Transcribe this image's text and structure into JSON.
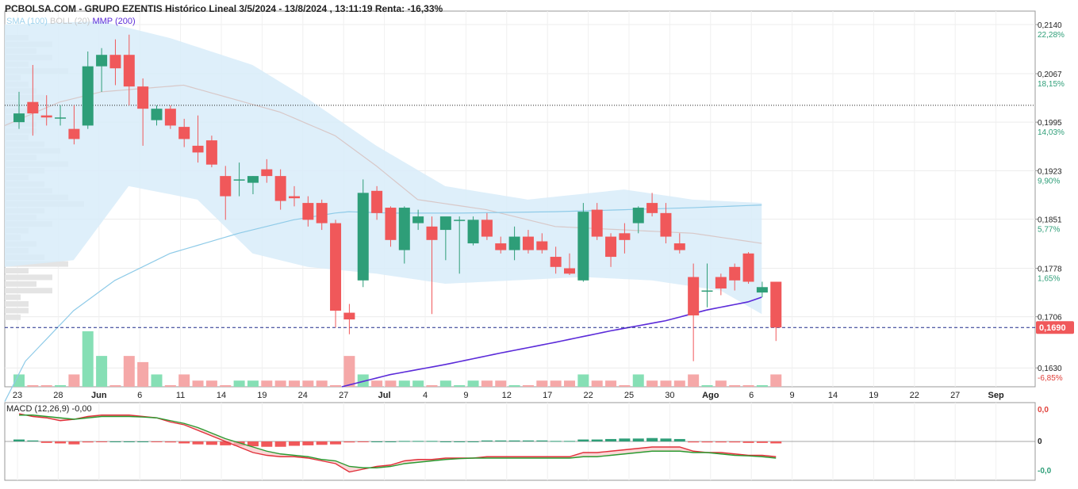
{
  "header": {
    "title": "PCBOLSA.COM - GRUPO EZENTIS Histórico Lineal 3/5/2024 - 13/8/2024 , 13:11:19 Renta: -16,33%"
  },
  "legend": [
    {
      "label": "SMA (100)",
      "color": "#9fd3ee"
    },
    {
      "label": "BOLL (20)",
      "color": "#c8c8c8"
    },
    {
      "label": "MMP (200)",
      "color": "#5b2bd9"
    }
  ],
  "colors": {
    "up": "#2e9e78",
    "down": "#f0585a",
    "vol_up": "#86dfb5",
    "vol_down": "#f5a8a8",
    "boll_fill": "#d8ecf9",
    "sma": "#8fcbe8",
    "mmp": "#5b2bd9",
    "macd_line": "#e0303a",
    "signal_line": "#2a9a30"
  },
  "chart_data": [
    {
      "type": "candlestick",
      "title": "PCBOLSA.COM - GRUPO EZENTIS Histórico Lineal 3/5/2024 - 13/8/2024 , 13:11:19 Renta: -16,33%",
      "ylim": [
        0.1602,
        0.216
      ],
      "y_ticks": [
        {
          "value": 0.214,
          "label": "0,2140",
          "pct": "22,28%"
        },
        {
          "value": 0.2067,
          "label": "0,2067",
          "pct": "18,15%"
        },
        {
          "value": 0.1995,
          "label": "0,1995",
          "pct": "14,03%"
        },
        {
          "value": 0.1923,
          "label": "0,1923",
          "pct": "9,90%"
        },
        {
          "value": 0.1851,
          "label": "5,77%",
          "pct": "5,77%",
          "price": "0,1851"
        },
        {
          "value": 0.1778,
          "label": "0,1778",
          "pct": "1,65%"
        },
        {
          "value": 0.1706,
          "label": "0,1706",
          "pct": "-2,47%"
        },
        {
          "value": 0.163,
          "label": "0,1630",
          "pct": "-6,85%"
        }
      ],
      "x_ticks": [
        "23",
        "28",
        "Jun",
        "6",
        "11",
        "14",
        "19",
        "24",
        "27",
        "Jul",
        "4",
        "9",
        "12",
        "17",
        "22",
        "25",
        "30",
        "Ago",
        "6",
        "9",
        "14",
        "19",
        "22",
        "27",
        "Sep"
      ],
      "last_price": "0,1690",
      "reference_price": 0.202,
      "candles": [
        {
          "o": 0.1995,
          "h": 0.204,
          "l": 0.1985,
          "c": 0.2008
        },
        {
          "o": 0.2025,
          "h": 0.208,
          "l": 0.1975,
          "c": 0.2008
        },
        {
          "o": 0.2005,
          "h": 0.2035,
          "l": 0.199,
          "c": 0.2002
        },
        {
          "o": 0.2002,
          "h": 0.202,
          "l": 0.199,
          "c": 0.2002
        },
        {
          "o": 0.1985,
          "h": 0.202,
          "l": 0.1962,
          "c": 0.197
        },
        {
          "o": 0.199,
          "h": 0.21,
          "l": 0.1985,
          "c": 0.2078
        },
        {
          "o": 0.2078,
          "h": 0.2105,
          "l": 0.204,
          "c": 0.2095
        },
        {
          "o": 0.2095,
          "h": 0.2118,
          "l": 0.205,
          "c": 0.2075
        },
        {
          "o": 0.2095,
          "h": 0.2125,
          "l": 0.202,
          "c": 0.2048
        },
        {
          "o": 0.2048,
          "h": 0.206,
          "l": 0.196,
          "c": 0.2015
        },
        {
          "o": 0.1998,
          "h": 0.202,
          "l": 0.199,
          "c": 0.2015
        },
        {
          "o": 0.2015,
          "h": 0.202,
          "l": 0.1985,
          "c": 0.199
        },
        {
          "o": 0.1988,
          "h": 0.2,
          "l": 0.1958,
          "c": 0.197
        },
        {
          "o": 0.196,
          "h": 0.2005,
          "l": 0.1935,
          "c": 0.195
        },
        {
          "o": 0.1968,
          "h": 0.1975,
          "l": 0.1928,
          "c": 0.1932
        },
        {
          "o": 0.1915,
          "h": 0.193,
          "l": 0.185,
          "c": 0.1885
        },
        {
          "o": 0.191,
          "h": 0.1935,
          "l": 0.1885,
          "c": 0.191
        },
        {
          "o": 0.1905,
          "h": 0.1915,
          "l": 0.1888,
          "c": 0.1915
        },
        {
          "o": 0.1925,
          "h": 0.194,
          "l": 0.1905,
          "c": 0.1915
        },
        {
          "o": 0.1915,
          "h": 0.1925,
          "l": 0.1865,
          "c": 0.1878
        },
        {
          "o": 0.1885,
          "h": 0.19,
          "l": 0.187,
          "c": 0.1882
        },
        {
          "o": 0.1875,
          "h": 0.1885,
          "l": 0.184,
          "c": 0.185
        },
        {
          "o": 0.1875,
          "h": 0.188,
          "l": 0.1835,
          "c": 0.1845
        },
        {
          "o": 0.1845,
          "h": 0.185,
          "l": 0.169,
          "c": 0.1715
        },
        {
          "o": 0.1712,
          "h": 0.1725,
          "l": 0.168,
          "c": 0.1702
        },
        {
          "o": 0.176,
          "h": 0.191,
          "l": 0.175,
          "c": 0.189
        },
        {
          "o": 0.1893,
          "h": 0.19,
          "l": 0.185,
          "c": 0.186
        },
        {
          "o": 0.1868,
          "h": 0.187,
          "l": 0.181,
          "c": 0.182
        },
        {
          "o": 0.1805,
          "h": 0.187,
          "l": 0.1785,
          "c": 0.1868
        },
        {
          "o": 0.1845,
          "h": 0.1865,
          "l": 0.1835,
          "c": 0.1855
        },
        {
          "o": 0.184,
          "h": 0.1855,
          "l": 0.171,
          "c": 0.182
        },
        {
          "o": 0.1835,
          "h": 0.185,
          "l": 0.179,
          "c": 0.1855
        },
        {
          "o": 0.185,
          "h": 0.1855,
          "l": 0.177,
          "c": 0.185
        },
        {
          "o": 0.1815,
          "h": 0.1855,
          "l": 0.1812,
          "c": 0.185
        },
        {
          "o": 0.185,
          "h": 0.186,
          "l": 0.182,
          "c": 0.1825
        },
        {
          "o": 0.1815,
          "h": 0.1825,
          "l": 0.18,
          "c": 0.1805
        },
        {
          "o": 0.1805,
          "h": 0.184,
          "l": 0.179,
          "c": 0.1825
        },
        {
          "o": 0.1825,
          "h": 0.1835,
          "l": 0.18,
          "c": 0.1805
        },
        {
          "o": 0.1818,
          "h": 0.183,
          "l": 0.18,
          "c": 0.1805
        },
        {
          "o": 0.1795,
          "h": 0.181,
          "l": 0.177,
          "c": 0.178
        },
        {
          "o": 0.1778,
          "h": 0.18,
          "l": 0.1768,
          "c": 0.177
        },
        {
          "o": 0.176,
          "h": 0.1875,
          "l": 0.1758,
          "c": 0.1862
        },
        {
          "o": 0.1865,
          "h": 0.1875,
          "l": 0.182,
          "c": 0.1825
        },
        {
          "o": 0.1825,
          "h": 0.183,
          "l": 0.178,
          "c": 0.1795
        },
        {
          "o": 0.183,
          "h": 0.1845,
          "l": 0.18,
          "c": 0.182
        },
        {
          "o": 0.1845,
          "h": 0.187,
          "l": 0.183,
          "c": 0.1868
        },
        {
          "o": 0.1875,
          "h": 0.189,
          "l": 0.1855,
          "c": 0.186
        },
        {
          "o": 0.186,
          "h": 0.1875,
          "l": 0.1815,
          "c": 0.1825
        },
        {
          "o": 0.1815,
          "h": 0.183,
          "l": 0.18,
          "c": 0.1805
        },
        {
          "o": 0.1765,
          "h": 0.1785,
          "l": 0.164,
          "c": 0.1708
        },
        {
          "o": 0.1745,
          "h": 0.1785,
          "l": 0.172,
          "c": 0.1745
        },
        {
          "o": 0.1765,
          "h": 0.177,
          "l": 0.1738,
          "c": 0.1748
        },
        {
          "o": 0.178,
          "h": 0.1785,
          "l": 0.1745,
          "c": 0.176
        },
        {
          "o": 0.18,
          "h": 0.1802,
          "l": 0.1755,
          "c": 0.1758
        },
        {
          "o": 0.1742,
          "h": 0.1758,
          "l": 0.1735,
          "c": 0.175
        },
        {
          "o": 0.1758,
          "h": 0.1758,
          "l": 0.167,
          "c": 0.169
        }
      ],
      "volume": [
        2,
        0,
        0,
        0,
        2,
        9,
        5,
        0,
        5,
        4,
        2,
        0,
        2,
        1,
        1,
        0,
        1,
        1,
        1,
        1,
        1,
        1,
        1,
        0,
        5,
        2,
        1,
        1,
        1,
        1,
        0,
        1,
        0,
        1,
        1,
        1,
        0,
        0,
        1,
        1,
        1,
        2,
        1,
        1,
        0,
        2,
        1,
        1,
        1,
        2,
        0,
        1,
        0,
        0,
        0,
        2
      ],
      "sma": [
        [
          0.158,
          0
        ],
        [
          0.164,
          1.5
        ],
        [
          0.1715,
          5
        ],
        [
          0.176,
          8
        ],
        [
          0.18,
          12
        ],
        [
          0.183,
          17
        ],
        [
          0.185,
          21
        ],
        [
          0.186,
          24
        ],
        [
          0.1862,
          25
        ],
        [
          0.186,
          28
        ],
        [
          0.186,
          33
        ],
        [
          0.1862,
          40
        ],
        [
          0.1865,
          45
        ],
        [
          0.1868,
          50
        ],
        [
          0.1872,
          55
        ]
      ],
      "mmp": [
        [
          0.1602,
          24.5
        ],
        [
          0.162,
          28
        ],
        [
          0.1635,
          32
        ],
        [
          0.1652,
          36
        ],
        [
          0.1668,
          40
        ],
        [
          0.1685,
          44
        ],
        [
          0.17,
          48
        ],
        [
          0.1716,
          51
        ],
        [
          0.1728,
          54
        ],
        [
          0.1735,
          55
        ]
      ],
      "boll_mid": [
        [
          0.199,
          0
        ],
        [
          0.2025,
          4
        ],
        [
          0.204,
          7
        ],
        [
          0.205,
          13
        ],
        [
          0.201,
          20
        ],
        [
          0.1975,
          24
        ],
        [
          0.193,
          27
        ],
        [
          0.188,
          30
        ],
        [
          0.1865,
          35
        ],
        [
          0.184,
          40
        ],
        [
          0.1835,
          45
        ],
        [
          0.183,
          50
        ],
        [
          0.1815,
          55
        ]
      ],
      "boll_upper": [
        [
          0.214,
          0
        ],
        [
          0.2145,
          7
        ],
        [
          0.212,
          12
        ],
        [
          0.208,
          18
        ],
        [
          0.203,
          22
        ],
        [
          0.196,
          27
        ],
        [
          0.19,
          32
        ],
        [
          0.188,
          38
        ],
        [
          0.1895,
          45
        ],
        [
          0.188,
          50
        ],
        [
          0.1875,
          55
        ]
      ],
      "boll_lower": [
        [
          0.178,
          0
        ],
        [
          0.179,
          5
        ],
        [
          0.19,
          9
        ],
        [
          0.188,
          14
        ],
        [
          0.18,
          18
        ],
        [
          0.178,
          22
        ],
        [
          0.177,
          27
        ],
        [
          0.1755,
          32
        ],
        [
          0.176,
          37
        ],
        [
          0.1765,
          42
        ],
        [
          0.176,
          47
        ],
        [
          0.1745,
          52
        ],
        [
          0.171,
          55
        ]
      ]
    },
    {
      "type": "macd",
      "title": "MACD (12,26,9)",
      "value": "-0,00",
      "y_ticks": [
        "0,0",
        "0",
        "-0,0"
      ],
      "histogram": [
        0.2,
        0.1,
        -0.15,
        -0.2,
        -0.3,
        -0.1,
        -0.05,
        0,
        0,
        0,
        -0.05,
        -0.1,
        -0.2,
        -0.3,
        -0.35,
        -0.4,
        -0.45,
        -0.5,
        -0.55,
        -0.55,
        -0.45,
        -0.4,
        -0.35,
        -0.3,
        -0.1,
        -0.05,
        0,
        0,
        0.05,
        0.05,
        0.05,
        0,
        0,
        0,
        0.1,
        0.1,
        0.1,
        0.1,
        0.1,
        0.05,
        0.05,
        0.2,
        0.2,
        0.25,
        0.3,
        0.3,
        0.35,
        0.3,
        0.25,
        -0.1,
        -0.1,
        -0.1,
        -0.1,
        -0.15,
        -0.15,
        -0.2
      ],
      "macd": [
        1.0,
        0.9,
        0.85,
        0.75,
        0.8,
        0.9,
        0.95,
        0.95,
        0.95,
        0.9,
        0.85,
        0.7,
        0.6,
        0.4,
        0.2,
        0.0,
        -0.2,
        -0.4,
        -0.5,
        -0.55,
        -0.55,
        -0.6,
        -0.7,
        -0.8,
        -1.1,
        -1.0,
        -0.9,
        -0.85,
        -0.7,
        -0.65,
        -0.65,
        -0.6,
        -0.6,
        -0.6,
        -0.55,
        -0.55,
        -0.55,
        -0.55,
        -0.55,
        -0.55,
        -0.55,
        -0.4,
        -0.4,
        -0.35,
        -0.3,
        -0.25,
        -0.2,
        -0.2,
        -0.2,
        -0.35,
        -0.4,
        -0.4,
        -0.45,
        -0.5,
        -0.5,
        -0.55
      ],
      "signal": [
        0.95,
        0.95,
        0.9,
        0.85,
        0.8,
        0.85,
        0.9,
        0.9,
        0.9,
        0.88,
        0.85,
        0.75,
        0.65,
        0.5,
        0.3,
        0.1,
        -0.05,
        -0.2,
        -0.35,
        -0.45,
        -0.5,
        -0.55,
        -0.65,
        -0.7,
        -0.9,
        -0.95,
        -0.95,
        -0.9,
        -0.8,
        -0.75,
        -0.7,
        -0.65,
        -0.62,
        -0.6,
        -0.6,
        -0.6,
        -0.6,
        -0.6,
        -0.6,
        -0.6,
        -0.6,
        -0.55,
        -0.55,
        -0.5,
        -0.45,
        -0.4,
        -0.35,
        -0.35,
        -0.35,
        -0.4,
        -0.4,
        -0.45,
        -0.5,
        -0.52,
        -0.55,
        -0.6
      ]
    }
  ],
  "volume_profile": [
    3,
    6,
    4,
    6,
    3,
    8,
    2,
    3,
    4,
    5,
    2,
    3,
    6,
    4,
    4,
    3,
    5,
    7,
    4,
    8,
    5,
    3,
    5,
    6,
    8,
    10,
    5,
    4,
    6,
    3,
    2,
    4,
    3,
    5,
    8,
    3,
    6,
    4,
    6,
    2,
    3,
    3,
    2
  ]
}
